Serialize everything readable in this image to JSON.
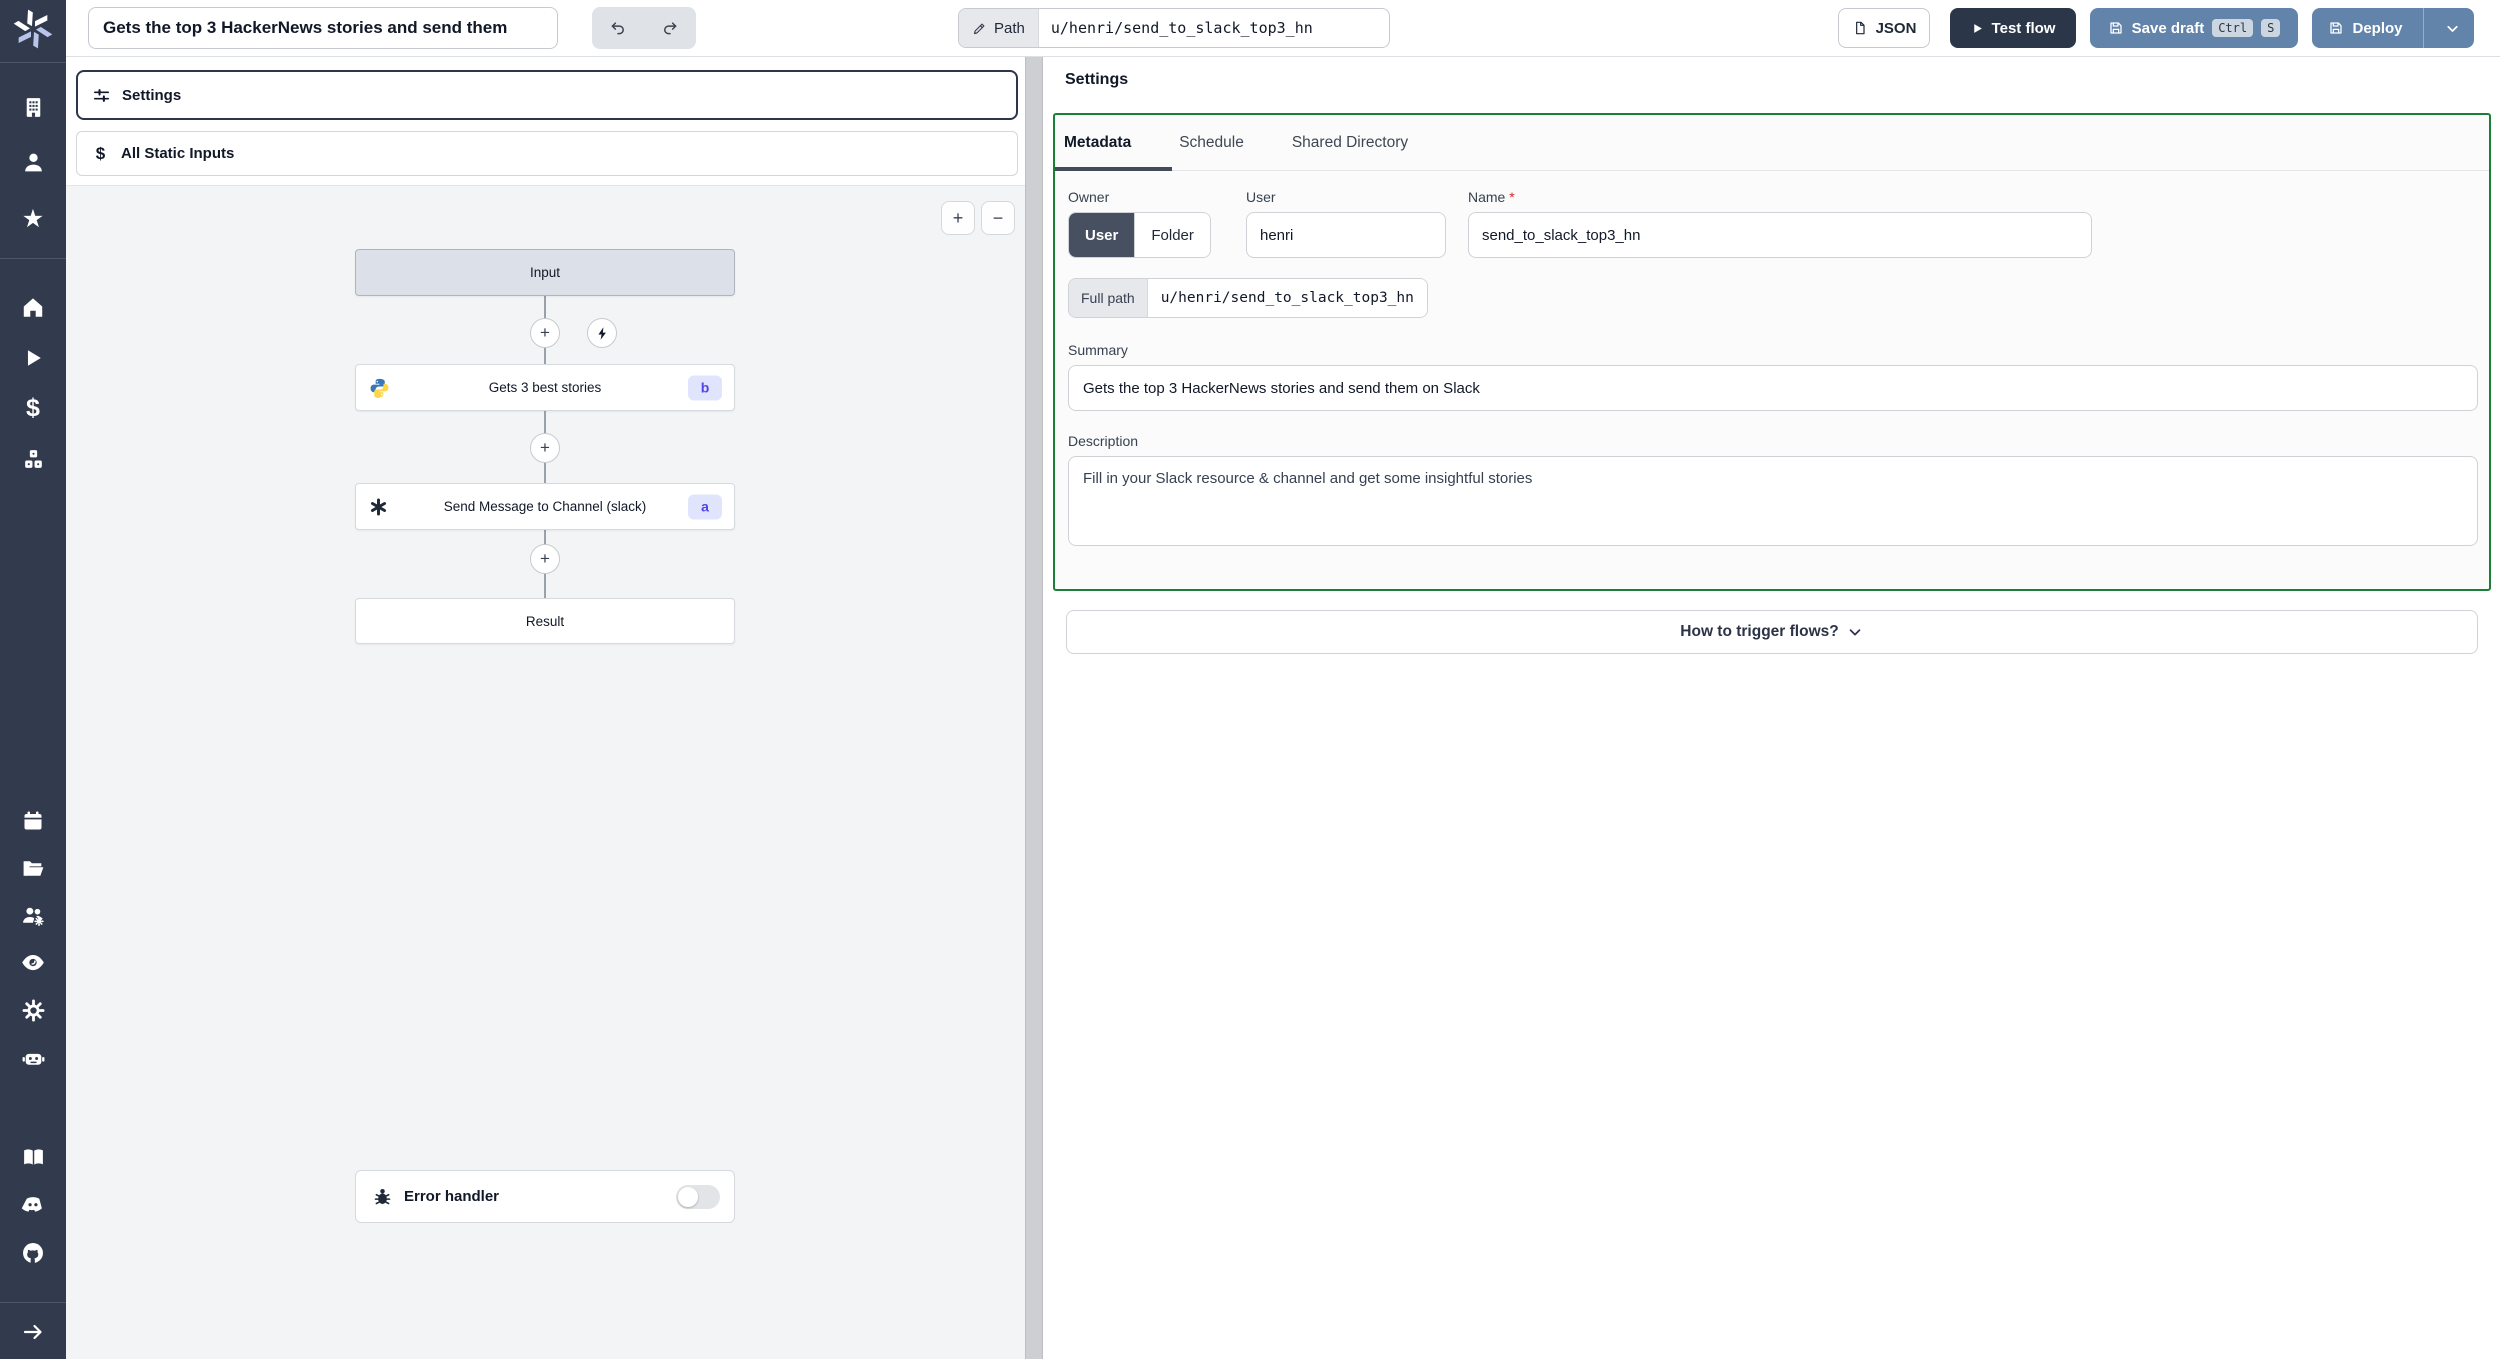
{
  "topbar": {
    "title_value": "Gets the top 3 HackerNews stories and send them",
    "path_chip_label": "Path",
    "path_value": "u/henri/send_to_slack_top3_hn",
    "json_button_label": "JSON",
    "test_flow_button_label": "Test flow",
    "save_draft_button_label": "Save draft",
    "save_draft_kbd": [
      "Ctrl",
      "S"
    ],
    "deploy_button_label": "Deploy"
  },
  "sidebar": {
    "icons": [
      "windmill-logo",
      "building",
      "user",
      "star",
      "home",
      "play",
      "dollar",
      "cubes",
      "calendar",
      "folder-open",
      "user-group-gear",
      "eye",
      "gear",
      "robot",
      "book-open",
      "discord",
      "github",
      "arrow-right"
    ],
    "dollar_glyph": "$",
    "star_glyph": "★"
  },
  "left_panel": {
    "settings_button_label": "Settings",
    "static_inputs_button_label": "All Static Inputs",
    "static_inputs_glyph": "$",
    "zoom_in_label": "+",
    "zoom_out_label": "−",
    "plus_glyph": "+"
  },
  "graph": {
    "nodes": [
      {
        "label": "Input"
      },
      {
        "label": "Gets 3 best stories",
        "badge": "b",
        "icon": "python-icon"
      },
      {
        "label": "Send Message to Channel (slack)",
        "badge": "a",
        "icon": "script-asterisk-icon"
      },
      {
        "label": "Result"
      }
    ],
    "error_handler_label": "Error handler",
    "error_handler_enabled": false
  },
  "settings_panel": {
    "heading": "Settings",
    "tabs": [
      {
        "label": "Metadata",
        "active": true
      },
      {
        "label": "Schedule",
        "active": false
      },
      {
        "label": "Shared Directory",
        "active": false
      }
    ],
    "owner_label": "Owner",
    "owner_options": [
      "User",
      "Folder"
    ],
    "owner_selected": "User",
    "user_label": "User",
    "user_value": "henri",
    "name_label": "Name",
    "name_required_mark": "*",
    "name_value": "send_to_slack_top3_hn",
    "full_path_label": "Full path",
    "full_path_value": "u/henri/send_to_slack_top3_hn",
    "summary_label": "Summary",
    "summary_value": "Gets the top 3 HackerNews stories and send them on Slack",
    "description_label": "Description",
    "description_value": "Fill in your Slack resource & channel and get some insightful stories",
    "trigger_button_label": "How to trigger flows?"
  },
  "colors": {
    "sidebar_bg": "#323b4d",
    "dark_button_bg": "#2b3648",
    "primary_button_bg": "#6283aa",
    "metadata_border_green": "#1a7f37",
    "badge_bg": "#e0e4fc",
    "badge_text": "#4f46e5",
    "required_mark": "#dc2626",
    "input_node_bg": "#dce0e8"
  }
}
